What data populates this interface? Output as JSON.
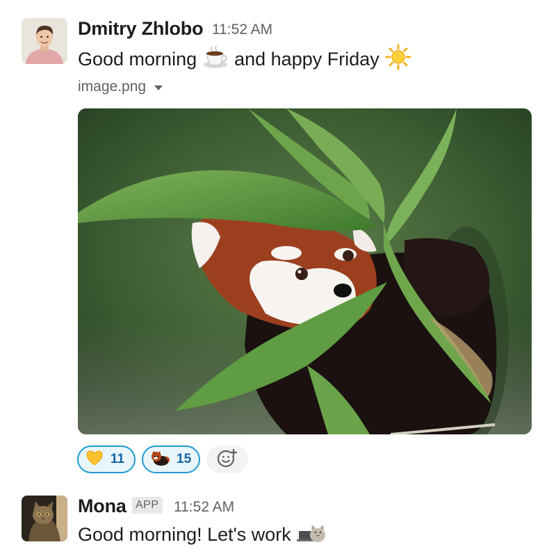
{
  "messages": [
    {
      "author": "Dmitry Zhlobo",
      "time": "11:52 AM",
      "text_part1": "Good morning",
      "emoji_1": "coffee-emoji",
      "text_part2": "and happy Friday",
      "emoji_2": "sun-emoji",
      "attachment": {
        "filename": "image.png",
        "image_subject": "red-panda-in-bamboo-leaves"
      },
      "reactions": [
        {
          "emoji": "yellow-heart-emoji",
          "count": "11"
        },
        {
          "emoji": "red-panda-emoji",
          "count": "15"
        }
      ],
      "add_reaction_icon": "add-reaction-icon"
    },
    {
      "author": "Mona",
      "badge": "APP",
      "time": "11:52 AM",
      "text": "Good morning! Let's work",
      "emoji": "cat-laptop-emoji"
    }
  ],
  "colors": {
    "reaction_border": "#1d9bd1",
    "reaction_bg": "#e8f5fa",
    "reaction_count": "#1264a3",
    "timestamp": "#616061"
  }
}
